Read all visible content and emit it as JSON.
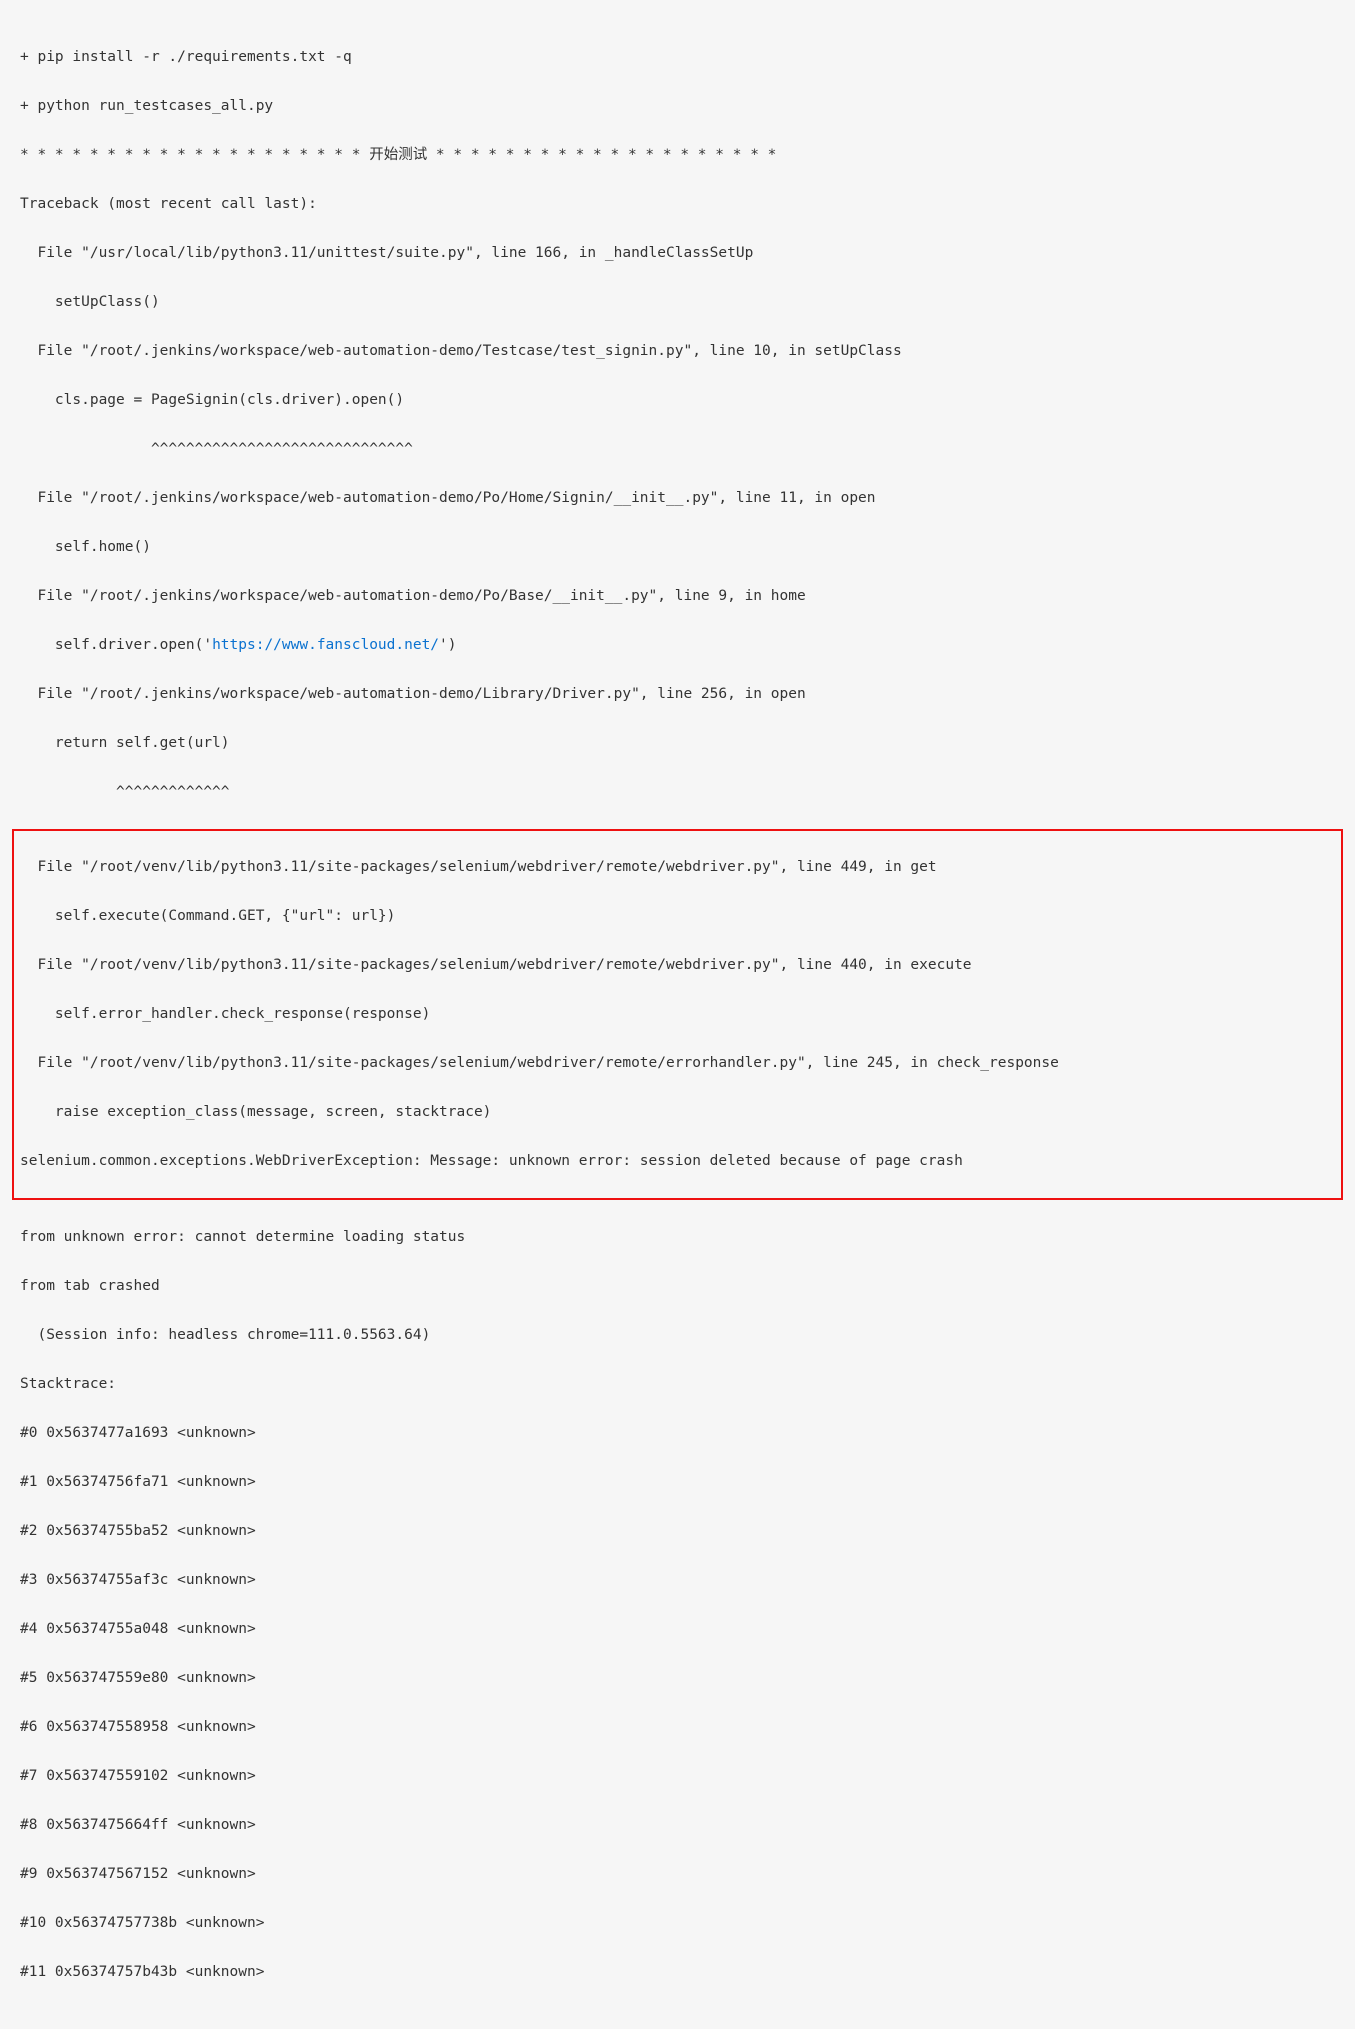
{
  "log": {
    "cmd1": "+ pip install -r ./requirements.txt -q",
    "cmd2": "+ python run_testcases_all.py",
    "banner": "* * * * * * * * * * * * * * * * * * * * 开始测试 * * * * * * * * * * * * * * * * * * * *",
    "tb_header": "Traceback (most recent call last):",
    "f1": "  File \"/usr/local/lib/python3.11/unittest/suite.py\", line 166, in _handleClassSetUp",
    "f1b": "    setUpClass()",
    "f2": "  File \"/root/.jenkins/workspace/web-automation-demo/Testcase/test_signin.py\", line 10, in setUpClass",
    "f2b": "    cls.page = PageSignin(cls.driver).open()",
    "f2c": "               ^^^^^^^^^^^^^^^^^^^^^^^^^^^^^^",
    "f3": "  File \"/root/.jenkins/workspace/web-automation-demo/Po/Home/Signin/__init__.py\", line 11, in open",
    "f3b": "    self.home()",
    "f4": "  File \"/root/.jenkins/workspace/web-automation-demo/Po/Base/__init__.py\", line 9, in home",
    "f4b_pre": "    self.driver.open('",
    "f4b_url": "https://www.fanscloud.net/",
    "f4b_post": "')",
    "f5": "  File \"/root/.jenkins/workspace/web-automation-demo/Library/Driver.py\", line 256, in open",
    "f5b": "    return self.get(url)",
    "f5c": "           ^^^^^^^^^^^^^",
    "h1": "  File \"/root/venv/lib/python3.11/site-packages/selenium/webdriver/remote/webdriver.py\", line 449, in get",
    "h1b": "    self.execute(Command.GET, {\"url\": url})",
    "h2": "  File \"/root/venv/lib/python3.11/site-packages/selenium/webdriver/remote/webdriver.py\", line 440, in execute",
    "h2b": "    self.error_handler.check_response(response)",
    "h3": "  File \"/root/venv/lib/python3.11/site-packages/selenium/webdriver/remote/errorhandler.py\", line 245, in check_response",
    "h3b": "    raise exception_class(message, screen, stacktrace)",
    "exc": "selenium.common.exceptions.WebDriverException: Message: unknown error: session deleted because of page crash",
    "post1": "from unknown error: cannot determine loading status",
    "post2": "from tab crashed",
    "post3": "  (Session info: headless chrome=111.0.5563.64)",
    "st_header": "Stacktrace:",
    "st0": "#0 0x5637477a1693 <unknown>",
    "st1": "#1 0x56374756fa71 <unknown>",
    "st2": "#2 0x56374755ba52 <unknown>",
    "st3": "#3 0x56374755af3c <unknown>",
    "st4": "#4 0x56374755a048 <unknown>",
    "st5": "#5 0x563747559e80 <unknown>",
    "st6": "#6 0x563747558958 <unknown>",
    "st7": "#7 0x563747559102 <unknown>",
    "st8": "#8 0x5637475664ff <unknown>",
    "st9": "#9 0x563747567152 <unknown>",
    "st10": "#10 0x56374757738b <unknown>",
    "st11": "#11 0x56374757b43b <unknown>"
  }
}
